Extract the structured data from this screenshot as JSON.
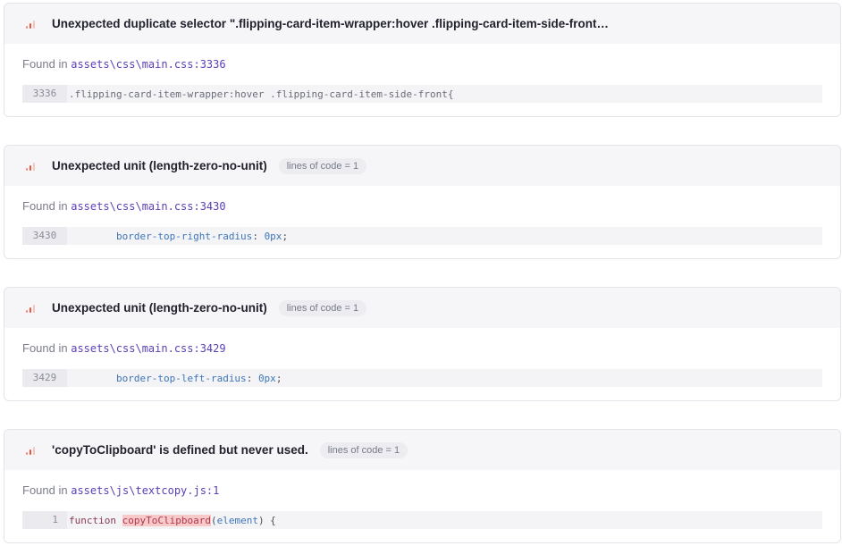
{
  "issues": [
    {
      "title": "Unexpected duplicate selector \".flipping-card-item-wrapper:hover .flipping-card-item-side-front…",
      "found_label": "Found in",
      "path": "assets\\css\\main.css:3336",
      "line_number": "3336",
      "code": ".flipping-card-item-wrapper:hover .flipping-card-item-side-front{"
    },
    {
      "title": "Unexpected unit (length-zero-no-unit)",
      "badge": "lines of code = 1",
      "found_label": "Found in",
      "path": "assets\\css\\main.css:3430",
      "line_number": "3430",
      "code_indent": "        ",
      "code_prop": "border-top-right-radius",
      "code_sep": ": ",
      "code_value": "0px",
      "code_end": ";"
    },
    {
      "title": "Unexpected unit (length-zero-no-unit)",
      "badge": "lines of code = 1",
      "found_label": "Found in",
      "path": "assets\\css\\main.css:3429",
      "line_number": "3429",
      "code_indent": "        ",
      "code_prop": "border-top-left-radius",
      "code_sep": ": ",
      "code_value": "0px",
      "code_end": ";"
    },
    {
      "title": "'copyToClipboard' is defined but never used.",
      "badge": "lines of code = 1",
      "found_label": "Found in",
      "path": "assets\\js\\textcopy.js:1",
      "line_number": "1",
      "code_keyword": "function",
      "code_name": "copyToClipboard",
      "code_open": "(",
      "code_arg": "element",
      "code_close": ") {"
    }
  ],
  "colors": {
    "accent_path": "#5b3fb5",
    "severity": "#e9553f",
    "highlight": "#f7c9c9"
  },
  "icons": {
    "severity": "severity-bars-icon"
  }
}
